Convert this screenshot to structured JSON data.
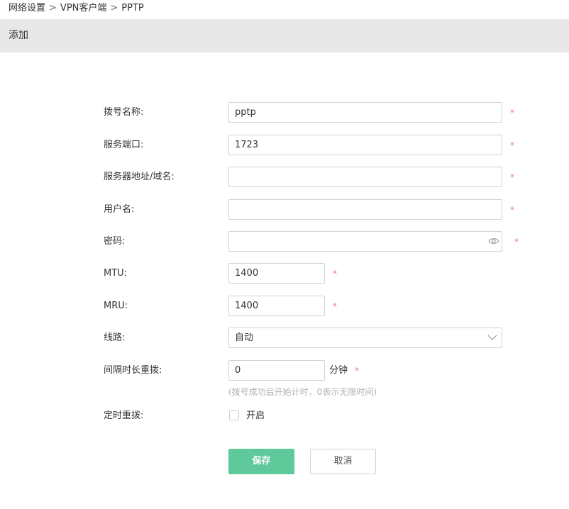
{
  "breadcrumb": {
    "items": [
      "网络设置",
      "VPN客户端",
      "PPTP"
    ],
    "separator": ">"
  },
  "section": {
    "title": "添加"
  },
  "form": {
    "dial_name": {
      "label": "拨号名称:",
      "value": "pptp",
      "required": "*"
    },
    "service_port": {
      "label": "服务端口:",
      "value": "1723",
      "required": "*"
    },
    "server_address": {
      "label": "服务器地址/域名:",
      "value": "",
      "required": "*"
    },
    "username": {
      "label": "用户名:",
      "value": "",
      "required": "*"
    },
    "password": {
      "label": "密码:",
      "value": "",
      "required": "*",
      "icon": "eye-icon"
    },
    "mtu": {
      "label": "MTU:",
      "value": "1400",
      "required": "*"
    },
    "mru": {
      "label": "MRU:",
      "value": "1400",
      "required": "*"
    },
    "line": {
      "label": "线路:",
      "selected": "自动",
      "icon": "chevron-down-icon"
    },
    "redial_interval": {
      "label": "间隔时长重拨:",
      "value": "0",
      "unit": "分钟",
      "required": "*",
      "hint": "(拨号成功后开始计时，0表示无限时间)"
    },
    "scheduled_redial": {
      "label": "定时重拨:",
      "checkbox_label": "开启",
      "checked": false
    }
  },
  "buttons": {
    "save": "保存",
    "cancel": "取消"
  },
  "colors": {
    "primary": "#5fc99b",
    "required": "#f07a78",
    "header_bg": "#e8e8e8",
    "hint": "#b0b0b0"
  }
}
